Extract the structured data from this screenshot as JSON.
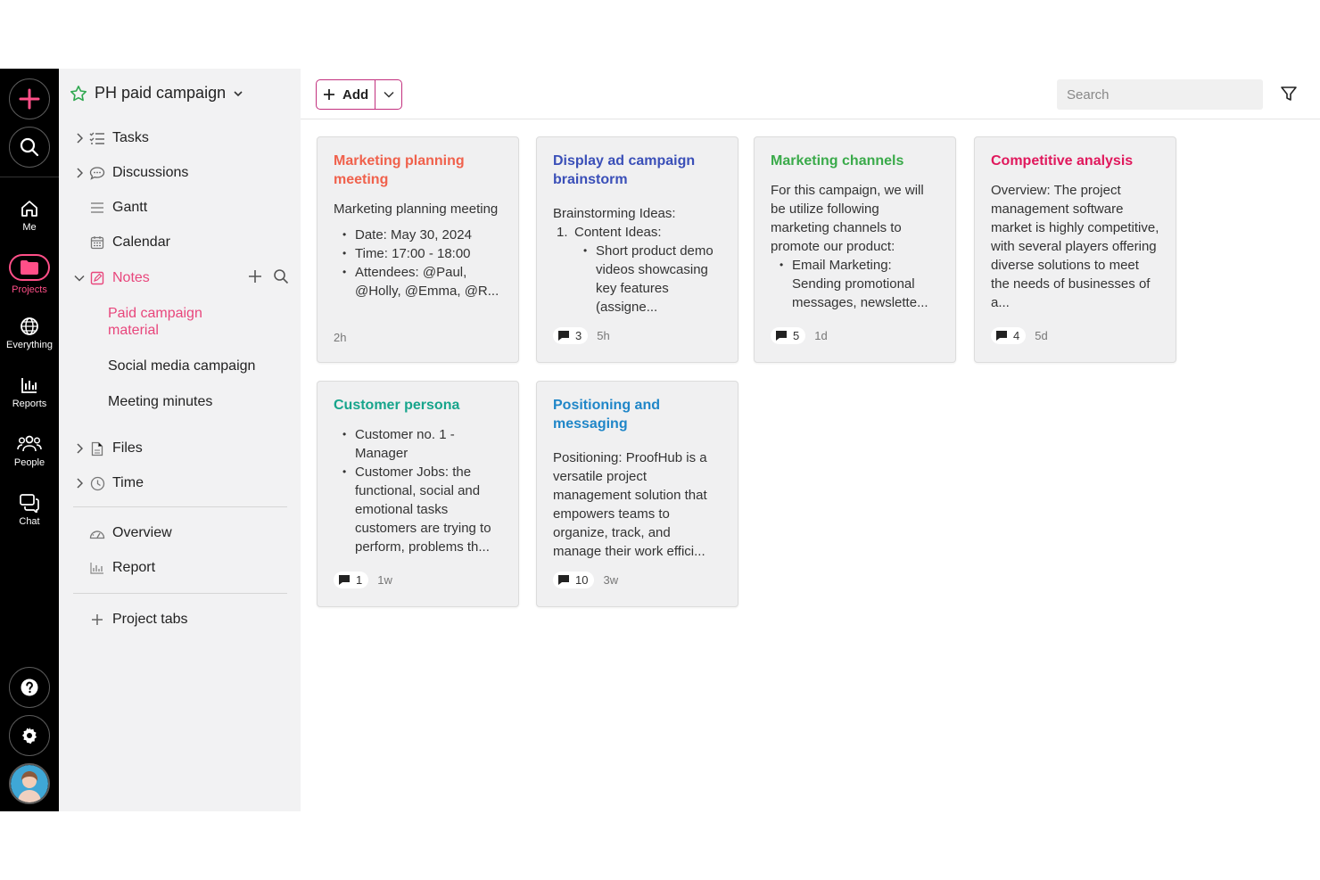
{
  "rail": {
    "items": [
      {
        "label": "Me"
      },
      {
        "label": "Projects"
      },
      {
        "label": "Everything"
      },
      {
        "label": "Reports"
      },
      {
        "label": "People"
      },
      {
        "label": "Chat"
      }
    ]
  },
  "sidebar": {
    "project_title": "PH paid campaign",
    "items": [
      {
        "label": "Tasks"
      },
      {
        "label": "Discussions"
      },
      {
        "label": "Gantt"
      },
      {
        "label": "Calendar"
      },
      {
        "label": "Notes"
      },
      {
        "label": "Files"
      },
      {
        "label": "Time"
      },
      {
        "label": "Overview"
      },
      {
        "label": "Report"
      },
      {
        "label": "Project tabs"
      }
    ],
    "notes": [
      {
        "label": "Paid campaign material"
      },
      {
        "label": "Social media campaign"
      },
      {
        "label": "Meeting minutes"
      }
    ]
  },
  "toolbar": {
    "add_label": "Add",
    "search_placeholder": "Search"
  },
  "colors": {
    "accent": "#e8467c",
    "rail_bg": "#000000",
    "sidebar_bg": "#f2f2f3"
  },
  "cards": [
    {
      "title": "Marketing planning meeting",
      "color": "#f0614c",
      "intro": "Marketing planning meeting",
      "bullets": [
        "Date: May 30, 2024",
        "Time: 17:00 - 18:00",
        "Attendees: @Paul, @Holly, @Emma, @R..."
      ],
      "comments": "",
      "age": "2h"
    },
    {
      "title": "Display ad campaign brainstorm",
      "color": "#3a4fb8",
      "intro": "Brainstorming Ideas:",
      "numbered": "1.",
      "numbered_text": "Content Ideas:",
      "bullets": [
        "Short product demo videos showcasing key features (assigne..."
      ],
      "comments": "3",
      "age": "5h"
    },
    {
      "title": "Marketing channels",
      "color": "#3aaa4a",
      "intro": "For this campaign, we will be utilize following marketing channels to promote our product:",
      "bullets": [
        "Email Marketing: Sending promotional messages, newslette..."
      ],
      "comments": "5",
      "age": "1d"
    },
    {
      "title": "Competitive analysis",
      "color": "#e0185c",
      "intro": "Overview: The project management software market is highly competitive, with several players offering diverse solutions to meet the needs of businesses of a...",
      "comments": "4",
      "age": "5d"
    },
    {
      "title": "Customer persona",
      "color": "#17a58c",
      "bullets": [
        "Customer no. 1 - Manager",
        "Customer Jobs: the functional, social and emotional tasks customers are trying to perform, problems th..."
      ],
      "comments": "1",
      "age": "1w"
    },
    {
      "title": "Positioning and messaging",
      "color": "#1f86c8",
      "intro": "Positioning: ProofHub is a versatile project management solution that empowers teams to organize, track, and manage their work effici...",
      "comments": "10",
      "age": "3w"
    }
  ]
}
